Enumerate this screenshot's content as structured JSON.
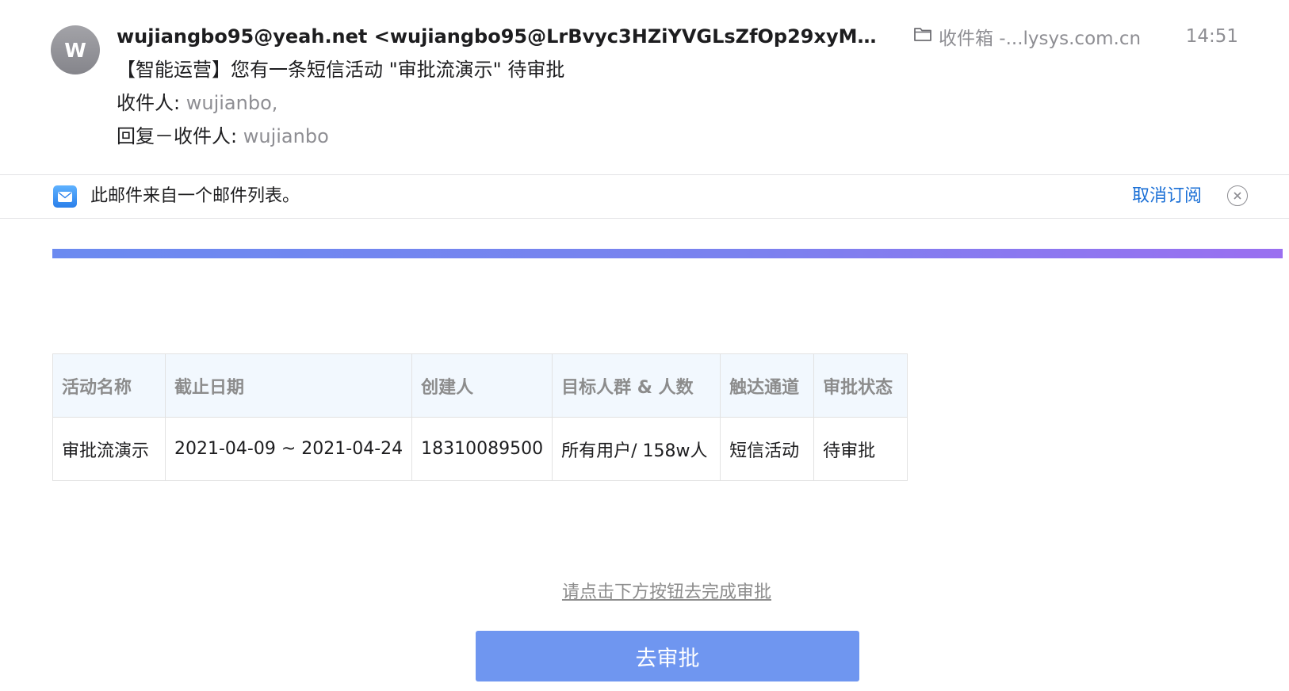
{
  "header": {
    "avatar_letter": "W",
    "from": "wujiangbo95@yeah.net <wujiangbo95@LrBvyc3HZiYVGLsZfOp29xyM...",
    "mailbox": "收件箱 -...lysys.com.cn",
    "time": "14:51",
    "subject": "【智能运营】您有一条短信活动 \"审批流演示\" 待审批",
    "to_label": "收件人:",
    "to_value": "wujianbo,",
    "reply_to_label": "回复－收件人:",
    "reply_to_value": "wujianbo"
  },
  "banner": {
    "text": "此邮件来自一个邮件列表。",
    "unsubscribe": "取消订阅"
  },
  "table": {
    "headers": [
      "活动名称",
      "截止日期",
      "创建人",
      "目标人群 & 人数",
      "触达通道",
      "审批状态"
    ],
    "rows": [
      [
        "审批流演示",
        "2021-04-09 ~ 2021-04-24",
        "18310089500",
        "所有用户/ 158w人",
        "短信活动",
        "待审批"
      ]
    ]
  },
  "prompt": "请点击下方按钮去完成审批",
  "button_label": "去审批",
  "colors": {
    "link_blue": "#1a6fd6",
    "button_blue": "#6f96f0",
    "header_bg": "#f2f8fe"
  }
}
